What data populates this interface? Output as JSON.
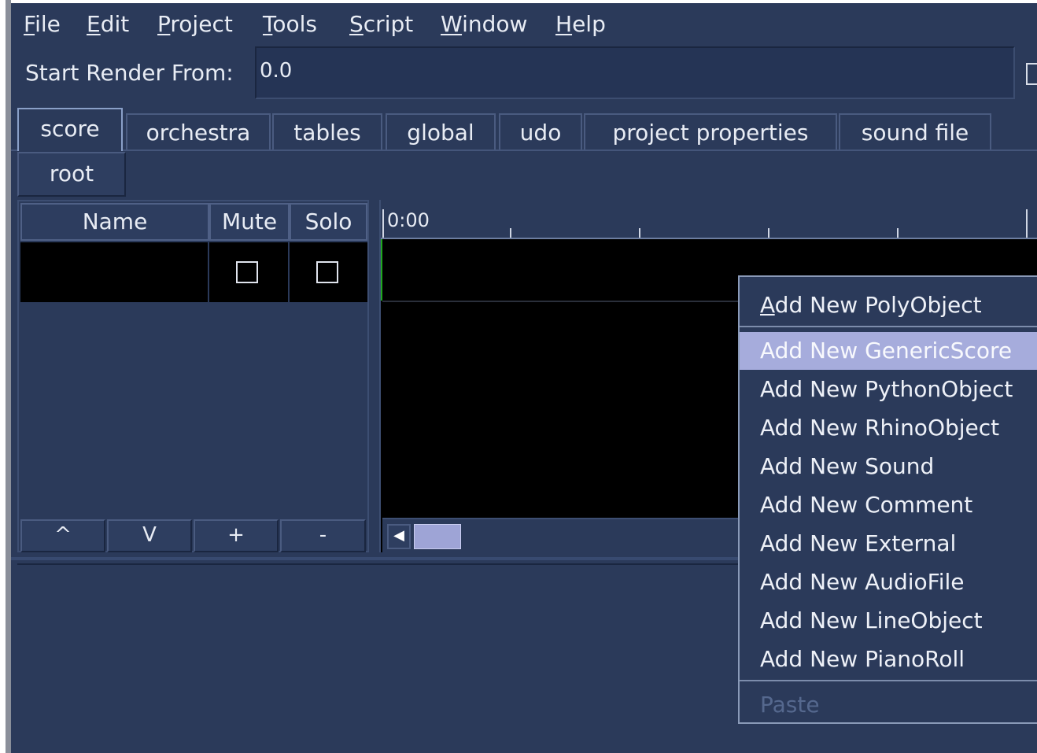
{
  "menubar": {
    "items": [
      {
        "mnemonic": "F",
        "rest": "ile"
      },
      {
        "mnemonic": "E",
        "rest": "dit"
      },
      {
        "mnemonic": "P",
        "rest": "roject"
      },
      {
        "mnemonic": "T",
        "rest": "ools"
      },
      {
        "mnemonic": "S",
        "rest": "cript"
      },
      {
        "mnemonic": "W",
        "rest": "indow"
      },
      {
        "mnemonic": "H",
        "rest": "elp"
      }
    ]
  },
  "render": {
    "label": "Start Render From:",
    "value": "0.0"
  },
  "tabs": [
    {
      "label": "score",
      "active": true
    },
    {
      "label": "orchestra"
    },
    {
      "label": "tables"
    },
    {
      "label": "global"
    },
    {
      "label": "udo"
    },
    {
      "label": "project properties"
    },
    {
      "label": "sound file"
    }
  ],
  "breadcrumb": {
    "root": "root"
  },
  "layers": {
    "columns": [
      "Name",
      "Mute",
      "Solo"
    ],
    "buttons": [
      "^",
      "V",
      "+",
      "-"
    ]
  },
  "timeline": {
    "start_label": "0:00"
  },
  "context_menu": {
    "items": [
      {
        "mnemonic": "A",
        "rest": "dd New PolyObject"
      },
      {
        "label": "Add New GenericScore",
        "selected": true
      },
      {
        "label": "Add New PythonObject"
      },
      {
        "label": "Add New RhinoObject"
      },
      {
        "label": "Add New Sound"
      },
      {
        "label": "Add New Comment"
      },
      {
        "label": "Add New External"
      },
      {
        "label": "Add New AudioFile"
      },
      {
        "label": "Add New LineObject"
      },
      {
        "label": "Add New PianoRoll"
      },
      {
        "label": "Paste",
        "disabled": true
      }
    ]
  },
  "colors": {
    "background": "#2b3a5a",
    "selection": "#a6acdc",
    "playhead": "#1fa81f"
  }
}
